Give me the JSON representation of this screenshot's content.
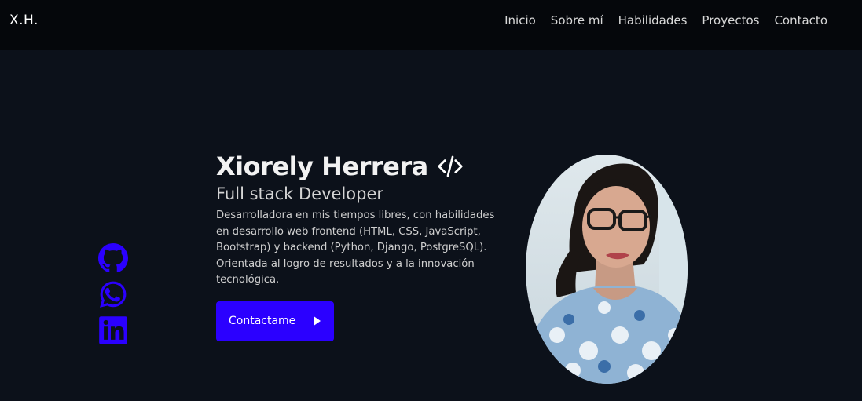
{
  "brand": {
    "label": "X.H."
  },
  "nav": {
    "items": [
      {
        "label": "Inicio"
      },
      {
        "label": "Sobre mí"
      },
      {
        "label": "Habilidades"
      },
      {
        "label": "Proyectos"
      },
      {
        "label": "Contacto"
      }
    ]
  },
  "socials": [
    {
      "icon": "github-icon"
    },
    {
      "icon": "whatsapp-icon"
    },
    {
      "icon": "linkedin-icon"
    }
  ],
  "hero": {
    "name": "Xiorely Herrera",
    "role": "Full stack Developer",
    "bio": "Desarrolladora en mis tiempos libres, con habilidades en desarrollo web frontend (HTML, CSS, JavaScript, Bootstrap) y backend (Python, Django, PostgreSQL). Orientada al logro de resultados y a la innovación tecnológica.",
    "cta_label": "Contactame",
    "code_icon": "code-icon",
    "cta_icon": "play-triangle-icon"
  },
  "colors": {
    "background": "#0c111a",
    "navbar": "#05070b",
    "accent": "#2b00ff",
    "social_icon": "#2b00ff"
  }
}
